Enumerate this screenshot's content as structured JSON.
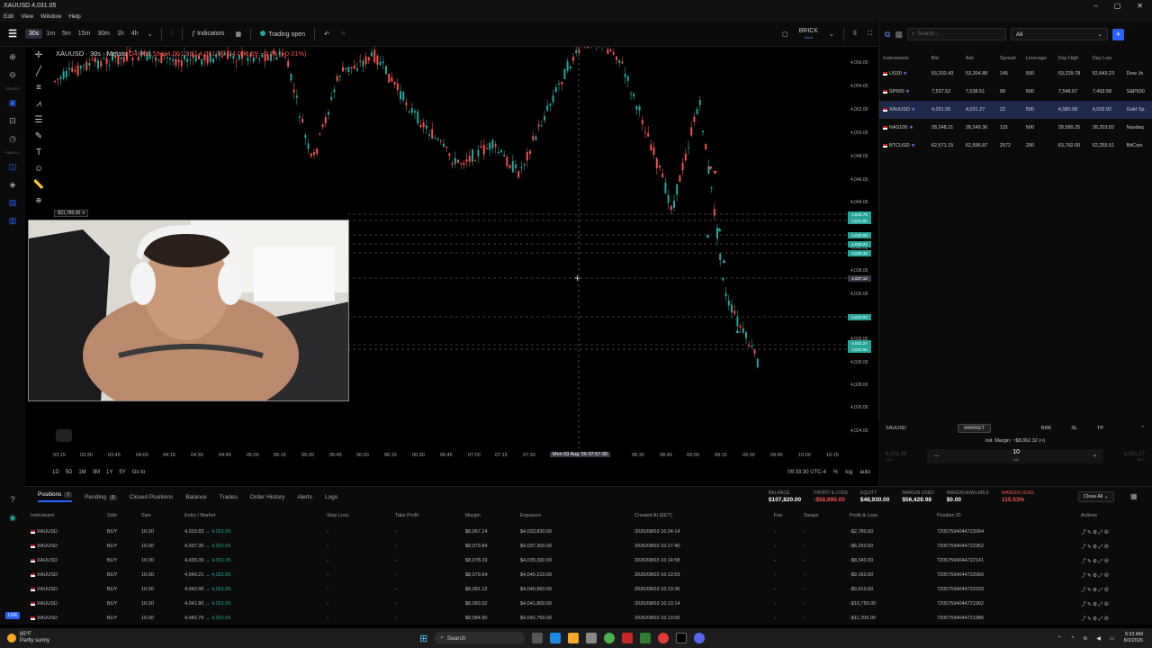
{
  "window": {
    "title": "XAUUSD 4,031.05",
    "controls": [
      "–",
      "▢",
      "✕"
    ]
  },
  "menu": [
    "Edit",
    "View",
    "Window",
    "Help"
  ],
  "toolbar": {
    "timeframes": [
      "30s",
      "1m",
      "5m",
      "15m",
      "30m",
      "1h",
      "4h"
    ],
    "active_timeframe": "30s",
    "indicators_label": "Indicators",
    "trading_status": "Trading open",
    "brick_label": "BRICK",
    "brick_sub": "Save"
  },
  "chart": {
    "symbol": "XAUUSD · 30s · Metals",
    "legend": {
      "o": "O4,061.59",
      "h": "H4,061.59",
      "l": "L4,061.59",
      "c": "C4,061.59 −0.24 (−0.01%)"
    },
    "pnl_tag": "-$11,780.00",
    "price_labels": [
      "4,056.00",
      "4,054.00",
      "4,052.00",
      "4,050.00",
      "4,048.00",
      "4,046.00",
      "4,044.00",
      "4,040.00",
      "4,038.00",
      "4,036.00",
      "4,034.00",
      "4,032.00",
      "4,030.00",
      "4,028.00",
      "4,026.00",
      "4,024.00"
    ],
    "price_tags": [
      "4,042.75",
      "4,041.80",
      "4,040.96",
      "4,040.21",
      "4,039.39",
      "4,037.16",
      "4,033.83",
      "4,031.27",
      "4,031.05"
    ],
    "time_labels": [
      "03:15",
      "03:30",
      "03:45",
      "04:00",
      "04:15",
      "04:30",
      "04:45",
      "05:00",
      "05:15",
      "05:30",
      "05:45",
      "06:00",
      "06:15",
      "06:30",
      "06:45",
      "07:00",
      "07:15",
      "07:30",
      "08:30",
      "08:45",
      "09:00",
      "09:15",
      "09:30",
      "09:45",
      "10:00",
      "10:15"
    ],
    "crosshair_time": "Mon 03 Aug '26 07:57:30",
    "ranges": [
      "1D",
      "5D",
      "1M",
      "3M",
      "1Y",
      "5Y",
      "Go to"
    ],
    "clock": "09:33:30 UTC-4",
    "scale_opts": [
      "%",
      "log",
      "auto"
    ]
  },
  "instruments": {
    "search_placeholder": "Search...",
    "filter": "All",
    "headers": [
      "Instruments",
      "Bid",
      "Ask",
      "Spread",
      "Leverage",
      "Day High",
      "Day Low",
      ""
    ],
    "rows": [
      {
        "name": "US30",
        "bid": "53,203.43",
        "ask": "53,204.88",
        "spread": "145",
        "lev": "500",
        "high": "53,229.78",
        "low": "52,643.23",
        "desc": "Dow Jo"
      },
      {
        "name": "SP500",
        "bid": "7,537.52",
        "ask": "7,538.51",
        "spread": "99",
        "lev": "500",
        "high": "7,548.07",
        "low": "7,493.58",
        "desc": "S&P500"
      },
      {
        "name": "XAUUSD",
        "bid": "4,031.05",
        "ask": "4,031.27",
        "spread": "22",
        "lev": "500",
        "high": "4,080.08",
        "low": "4,029.92",
        "desc": "Gold Sp"
      },
      {
        "name": "NAS100",
        "bid": "28,248.21",
        "ask": "28,249.36",
        "spread": "115",
        "lev": "500",
        "high": "28,589.25",
        "low": "28,203.82",
        "desc": "Nasdaq"
      },
      {
        "name": "BTCUSD",
        "bid": "62,571.15",
        "ask": "62,596.87",
        "spread": "2572",
        "lev": "200",
        "high": "63,792.00",
        "low": "62,255.51",
        "desc": "BitCoin"
      }
    ]
  },
  "order": {
    "symbol": "XAUUSD",
    "tabs": [
      "MARKET",
      "BRK",
      "SL",
      "TP"
    ],
    "margin_label": "Init. Margin: ~$8,062.32 (≈)",
    "sell_price": "4,031.05",
    "sell_label": "SELL",
    "buy_price": "4,031.27",
    "buy_label": "BUY",
    "qty": "10",
    "qty_unit": "lots"
  },
  "bottom": {
    "tabs": [
      {
        "label": "Positions",
        "count": "7"
      },
      {
        "label": "Pending",
        "count": "0"
      },
      {
        "label": "Closed Positions"
      },
      {
        "label": "Balance"
      },
      {
        "label": "Trades"
      },
      {
        "label": "Order History"
      },
      {
        "label": "Alerts"
      },
      {
        "label": "Logs"
      }
    ],
    "stats": [
      {
        "label": "BALANCE",
        "value": "$107,820.00",
        "neg": false
      },
      {
        "label": "PROFIT & LOSS",
        "value": "-$58,890.00",
        "neg": true
      },
      {
        "label": "EQUITY",
        "value": "$48,930.00",
        "neg": false
      },
      {
        "label": "MARGIN USED",
        "value": "$56,428.98",
        "neg": false
      },
      {
        "label": "MARGIN AVAILABLE",
        "value": "$0.00",
        "neg": false
      },
      {
        "label": "MARGIN LEVEL",
        "value": "115.53%",
        "neg": true
      }
    ],
    "close_all": "Close All",
    "headers": [
      "Instrument",
      "Side",
      "Size",
      "Entry / Market",
      "Stop Loss",
      "Take Profit",
      "Margin",
      "Exposure",
      "Created At (EET)",
      "Fee",
      "Swaps",
      "Profit & Loss",
      "Position ID",
      "Actions"
    ],
    "rows": [
      {
        "inst": "XAUUSD",
        "side": "BUY",
        "size": "10.00",
        "entry": "4,033.83",
        "mkt": "4,031.05",
        "sl": "-",
        "tp": "-",
        "margin": "$8,067.14",
        "exp": "$4,033,830.00",
        "created": "2026/08/03 16:24:14",
        "fee": "-",
        "swap": "-",
        "pl": "-$2,780.00",
        "id": "72057594044723064"
      },
      {
        "inst": "XAUUSD",
        "side": "BUY",
        "size": "10.00",
        "entry": "4,037.30",
        "mkt": "4,031.05",
        "sl": "-",
        "tp": "-",
        "margin": "$8,073.84",
        "exp": "$4,037,300.00",
        "created": "2026/08/03 16:17:40",
        "fee": "-",
        "swap": "-",
        "pl": "-$6,250.00",
        "id": "72057594044722362"
      },
      {
        "inst": "XAUUSD",
        "side": "BUY",
        "size": "10.00",
        "entry": "4,039.39",
        "mkt": "4,031.05",
        "sl": "-",
        "tp": "-",
        "margin": "$8,078.19",
        "exp": "$4,039,390.00",
        "created": "2026/08/03 16:14:58",
        "fee": "-",
        "swap": "-",
        "pl": "-$8,340.00",
        "id": "72057594044722141"
      },
      {
        "inst": "XAUUSD",
        "side": "BUY",
        "size": "10.00",
        "entry": "4,040.21",
        "mkt": "4,031.05",
        "sl": "-",
        "tp": "-",
        "margin": "$8,079.64",
        "exp": "$4,040,210.00",
        "created": "2026/08/03 16:13:53",
        "fee": "-",
        "swap": "-",
        "pl": "-$9,160.00",
        "id": "72057594044722060"
      },
      {
        "inst": "XAUUSD",
        "side": "BUY",
        "size": "10.00",
        "entry": "4,040.96",
        "mkt": "4,031.05",
        "sl": "-",
        "tp": "-",
        "margin": "$8,081.12",
        "exp": "$4,040,960.00",
        "created": "2026/08/03 16:13:36",
        "fee": "-",
        "swap": "-",
        "pl": "-$9,910.00",
        "id": "72057594044722029"
      },
      {
        "inst": "XAUUSD",
        "side": "BUY",
        "size": "10.00",
        "entry": "4,041.80",
        "mkt": "4,031.05",
        "sl": "-",
        "tp": "-",
        "margin": "$8,083.02",
        "exp": "$4,041,800.00",
        "created": "2026/08/03 16:13:14",
        "fee": "-",
        "swap": "-",
        "pl": "-$10,750.00",
        "id": "72057594044721992"
      },
      {
        "inst": "XAUUSD",
        "side": "BUY",
        "size": "10.00",
        "entry": "4,042.75",
        "mkt": "4,031.05",
        "sl": "-",
        "tp": "-",
        "margin": "$8,084.90",
        "exp": "$4,042,750.00",
        "created": "2026/08/03 16:13:05",
        "fee": "-",
        "swap": "-",
        "pl": "-$11,700.00",
        "id": "72057594044721986"
      }
    ]
  },
  "taskbar": {
    "temp": "85°F",
    "weather": "Partly sunny",
    "search": "Search",
    "time": "9:33 AM",
    "date": "8/3/2026"
  },
  "sidebar": {
    "spaces_label": "SPACES",
    "panels_label": "PANELS",
    "live_label": "LIVE"
  },
  "colors": {
    "up": "#26a69a",
    "down": "#ef5350",
    "accent": "#2962ff"
  }
}
